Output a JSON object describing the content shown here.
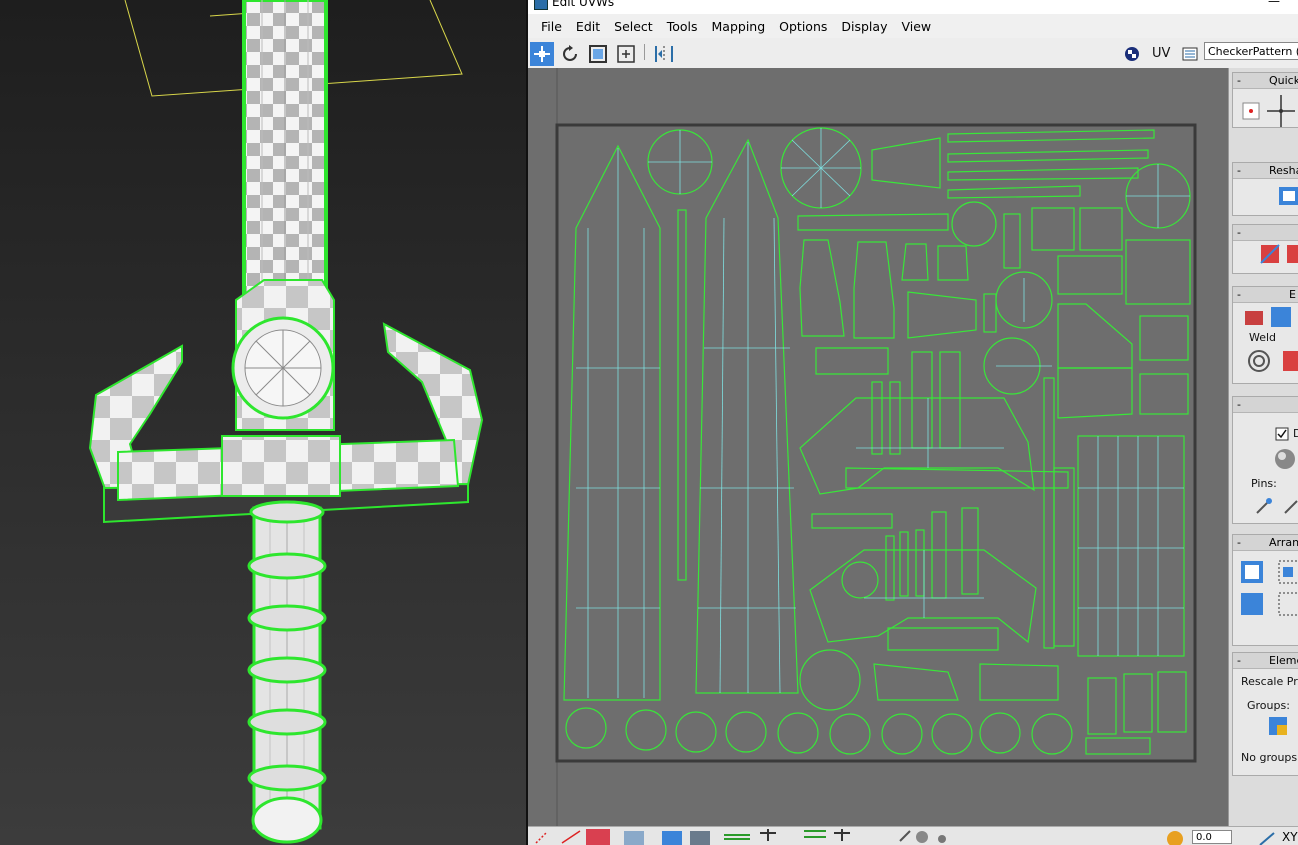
{
  "window": {
    "title": "Edit UVWs"
  },
  "menu": [
    "File",
    "Edit",
    "Select",
    "Tools",
    "Mapping",
    "Options",
    "Display",
    "View"
  ],
  "toolbar": {
    "uv_label": "UV",
    "texture_select": "CheckerPattern  ( C"
  },
  "panel": {
    "quick": {
      "title": "Quick"
    },
    "reshape": {
      "title": "Reshap"
    },
    "stitch": {
      "title": ""
    },
    "explode": {
      "title": "E",
      "weld_label": "Weld"
    },
    "peel": {
      "title": "",
      "checkbox_label": "D",
      "pins_label": "Pins:"
    },
    "arrange": {
      "title": "Arrang"
    },
    "elements": {
      "title": "Elemen",
      "rescale_label": "Rescale Prio",
      "groups_label": "Groups:",
      "no_groups": "No groups s"
    }
  },
  "statusbar": {
    "value": "0.0",
    "axis": "XY"
  },
  "colors": {
    "selection": "#39e639",
    "wire": "#7fe0e0",
    "canvas_bg": "#6e6e6e",
    "accent": "#2b7bd6"
  },
  "icons": [
    "move-icon",
    "rotate-icon",
    "scale-icon",
    "freeform-icon",
    "mirror-icon",
    "checker-icon",
    "texture-list-icon"
  ]
}
